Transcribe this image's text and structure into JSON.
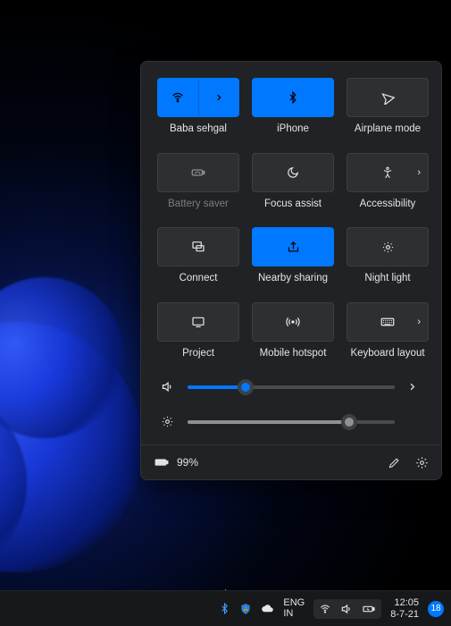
{
  "panel": {
    "tiles": {
      "wifi": {
        "label": "Baba sehgal",
        "active": true,
        "split": true
      },
      "bluetooth": {
        "label": "iPhone",
        "active": true
      },
      "airplane": {
        "label": "Airplane mode",
        "active": false
      },
      "battery": {
        "label": "Battery saver",
        "active": false,
        "disabled": true
      },
      "focus": {
        "label": "Focus assist",
        "active": false
      },
      "accessibility": {
        "label": "Accessibility",
        "active": false,
        "expandable": true
      },
      "connect": {
        "label": "Connect",
        "active": false
      },
      "nearby": {
        "label": "Nearby sharing",
        "active": true
      },
      "nightlight": {
        "label": "Night light",
        "active": false
      },
      "project": {
        "label": "Project",
        "active": false
      },
      "hotspot": {
        "label": "Mobile hotspot",
        "active": false
      },
      "keyboard": {
        "label": "Keyboard layout",
        "active": false,
        "expandable": true
      }
    },
    "volume_percent": 28,
    "brightness_percent": 78,
    "battery_text": "99%"
  },
  "taskbar": {
    "lang_top": "ENG",
    "lang_bottom": "IN",
    "time": "12:05",
    "date": "8-7-21",
    "notif_count": "18"
  },
  "colors": {
    "accent": "#0078ff",
    "panel_bg": "#202225"
  }
}
